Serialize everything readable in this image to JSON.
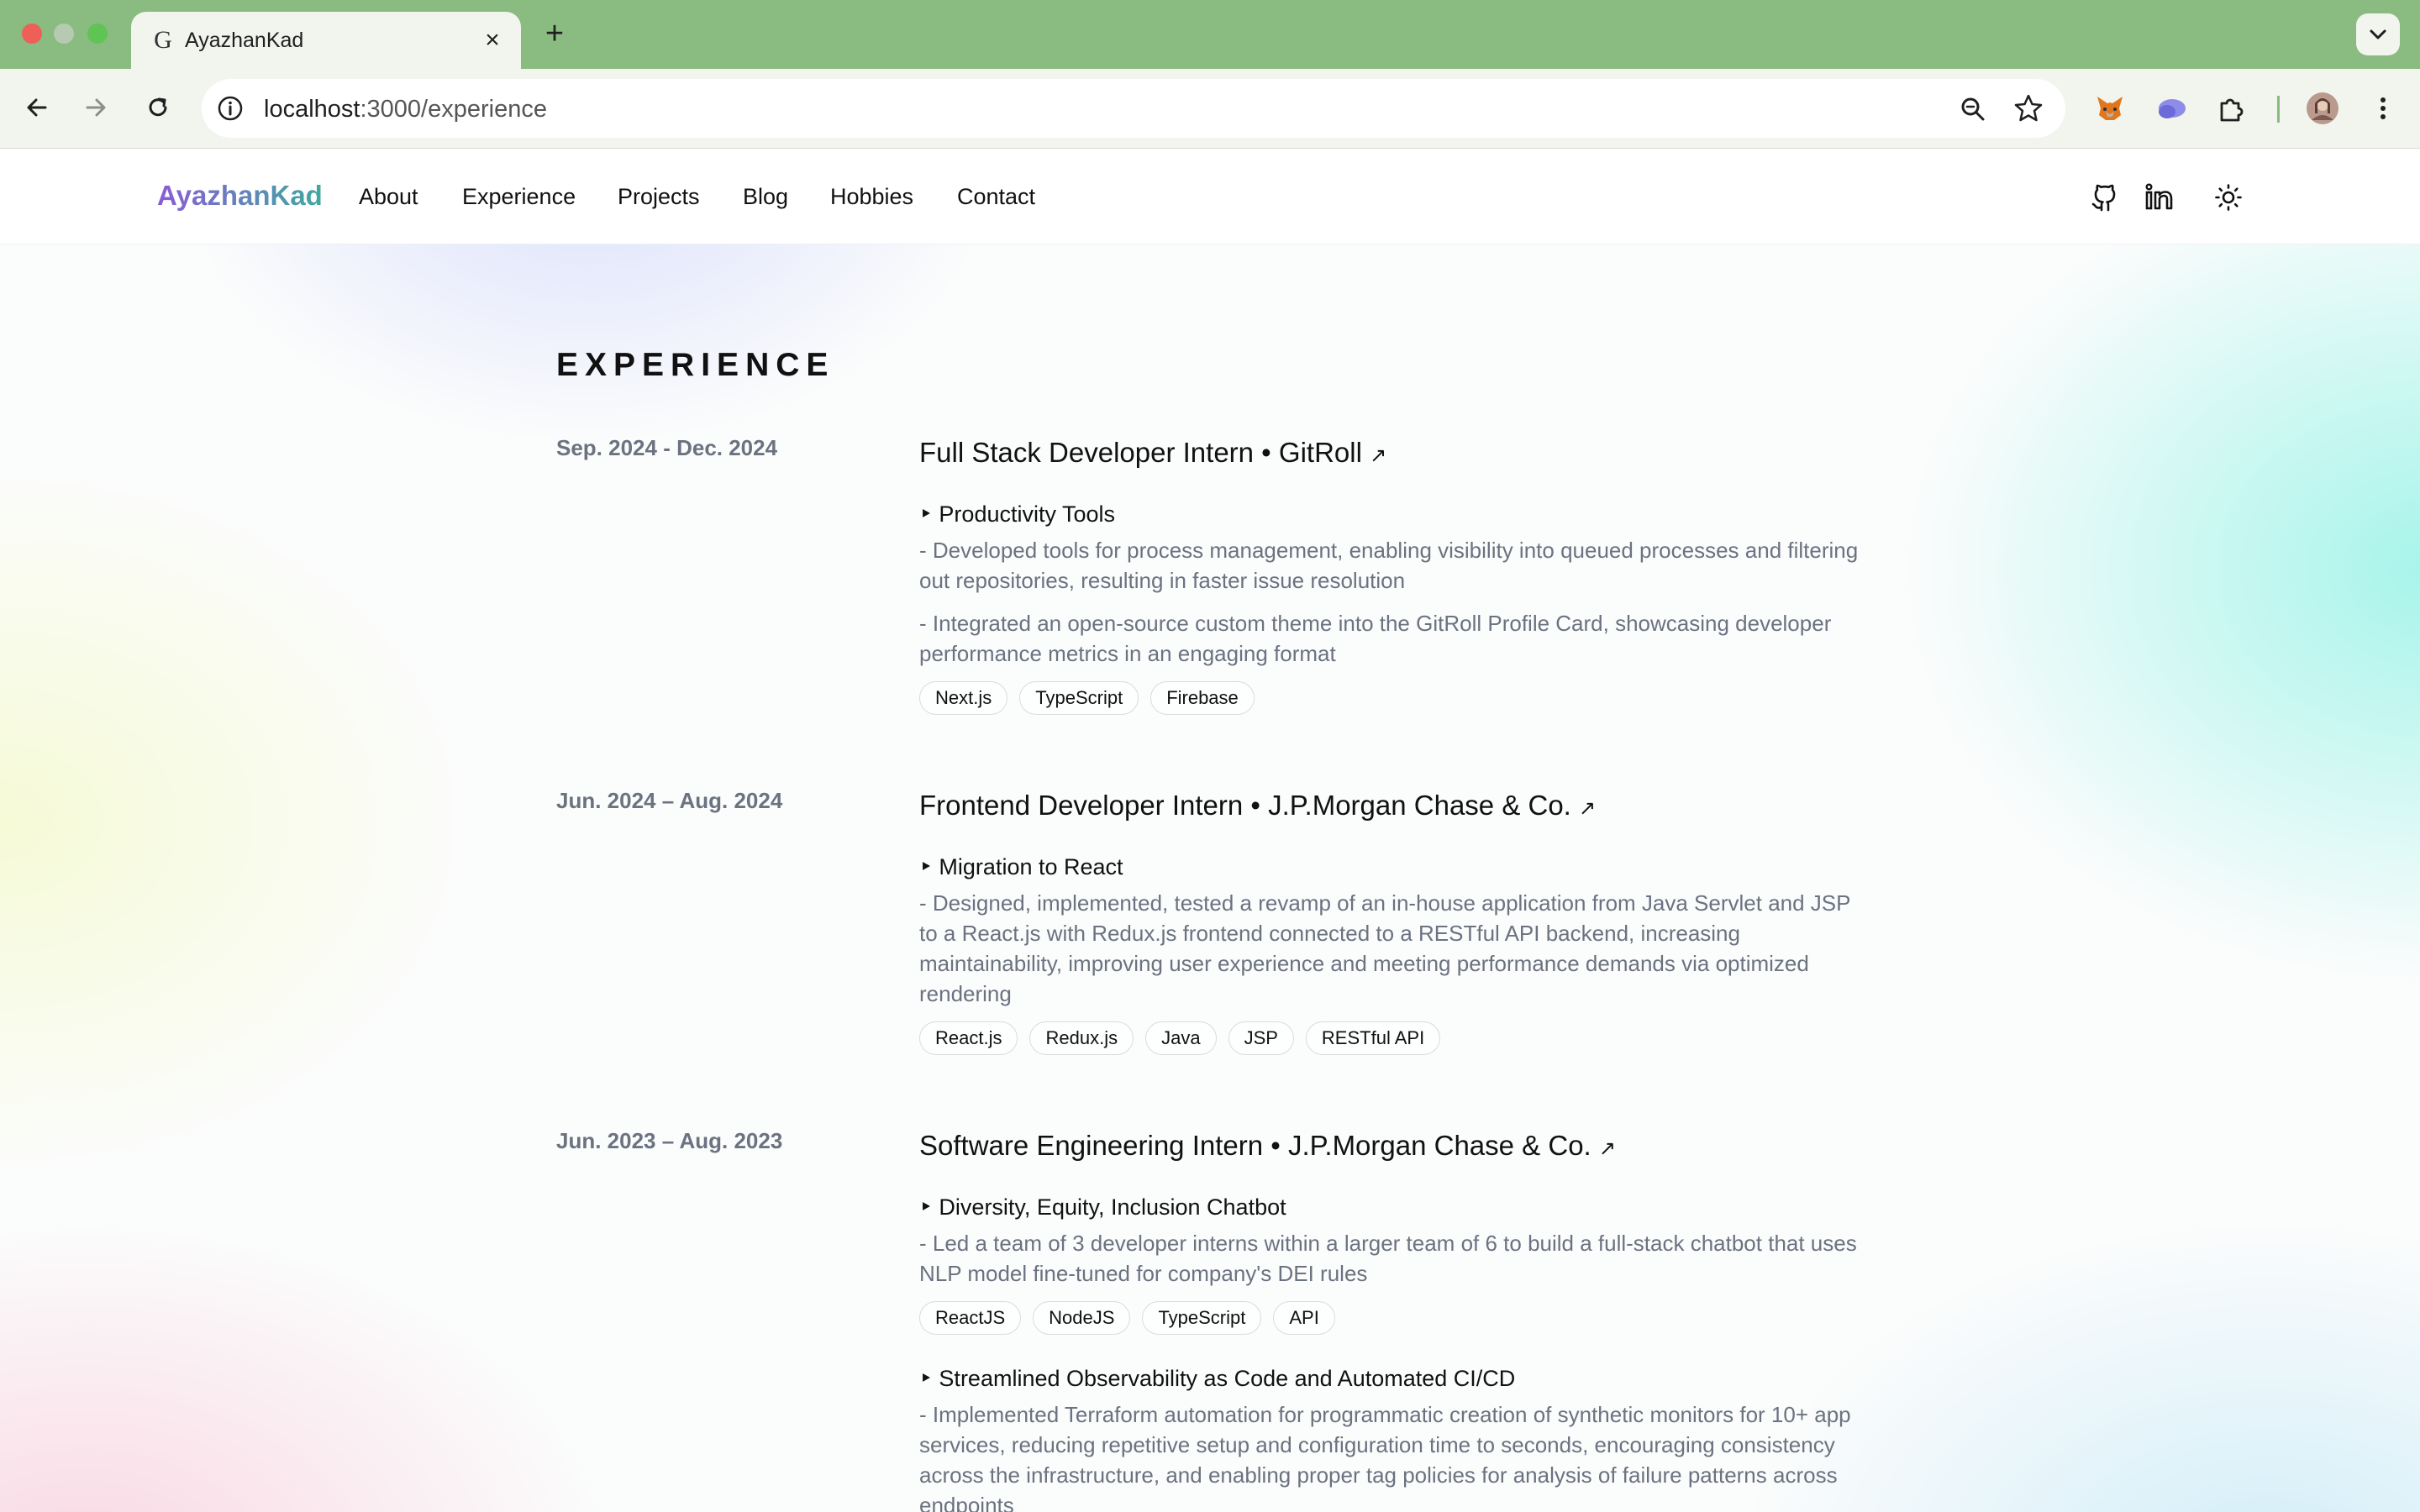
{
  "browser": {
    "tab_title": "AyazhanKad",
    "tab_favicon": "G",
    "url_host": "localhost",
    "url_path": ":3000/experience"
  },
  "nav": {
    "brand": "AyazhanKad",
    "links": [
      "About",
      "Experience",
      "Projects",
      "Blog",
      "Hobbies",
      "Contact"
    ],
    "icons": [
      "github-icon",
      "linkedin-icon",
      "sun-icon"
    ]
  },
  "page": {
    "title": "EXPERIENCE",
    "arrow": "↗",
    "experiences": [
      {
        "date": "Sep. 2024 - Dec. 2024",
        "title": "Full Stack Developer Intern • GitRoll",
        "projects": [
          {
            "name": "‣ Productivity Tools",
            "bullets": [
              "- Developed tools for process management, enabling visibility into queued processes and filtering out repositories, resulting in faster issue resolution",
              "- Integrated an open-source custom theme into the GitRoll Profile Card, showcasing developer performance metrics in an engaging format"
            ],
            "tags": [
              "Next.js",
              "TypeScript",
              "Firebase"
            ]
          }
        ]
      },
      {
        "date": "Jun. 2024 – Aug. 2024",
        "title": "Frontend Developer Intern • J.P.Morgan Chase & Co.",
        "projects": [
          {
            "name": "‣ Migration to React",
            "bullets": [
              "- Designed, implemented, tested a revamp of an in-house application from Java Servlet and JSP to a React.js with Redux.js frontend connected to a RESTful API backend, increasing maintainability, improving user experience and meeting performance demands via optimized rendering"
            ],
            "tags": [
              "React.js",
              "Redux.js",
              "Java",
              "JSP",
              "RESTful API"
            ]
          }
        ]
      },
      {
        "date": "Jun. 2023 – Aug. 2023",
        "title": "Software Engineering Intern • J.P.Morgan Chase & Co.",
        "projects": [
          {
            "name": "‣ Diversity, Equity, Inclusion Chatbot",
            "bullets": [
              "- Led a team of 3 developer interns within a larger team of 6 to build a full-stack chatbot that uses NLP model fine-tuned for company's DEI rules"
            ],
            "tags": [
              "ReactJS",
              "NodeJS",
              "TypeScript",
              "API"
            ]
          },
          {
            "name": "‣ Streamlined Observability as Code and Automated CI/CD",
            "bullets": [
              "- Implemented Terraform automation for programmatic creation of synthetic monitors for 10+ app services, reducing repetitive setup and configuration time to seconds, encouraging consistency across the infrastructure, and enabling proper tag policies for analysis of failure patterns across endpoints"
            ],
            "tags": []
          }
        ]
      }
    ]
  }
}
